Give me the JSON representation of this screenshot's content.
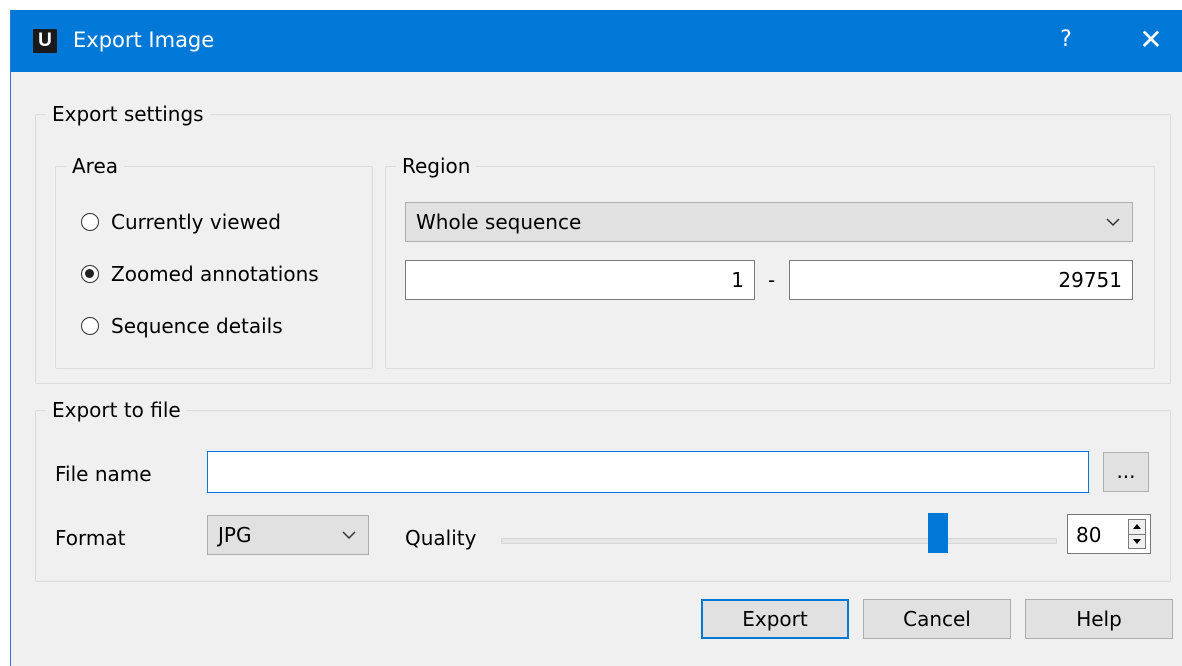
{
  "window": {
    "title": "Export Image",
    "app_logo": "U",
    "help": "?",
    "close": "✕"
  },
  "icons": {
    "chevron": "chevron-down-icon",
    "close": "close-icon",
    "help": "help-icon"
  },
  "colors": {
    "titlebar": "#0078d7",
    "accent": "#0078d7",
    "dialog_bg": "#f0f0f0"
  },
  "export_settings": {
    "legend": "Export settings",
    "area": {
      "legend": "Area",
      "options": [
        {
          "label": "Currently viewed",
          "checked": false
        },
        {
          "label": "Zoomed annotations",
          "checked": true
        },
        {
          "label": "Sequence details",
          "checked": false
        }
      ]
    },
    "region": {
      "legend": "Region",
      "selected": "Whole sequence",
      "start": "1",
      "separator": "-",
      "end": "29751"
    }
  },
  "export_to_file": {
    "legend": "Export to file",
    "file_name_label": "File name",
    "file_name_value": "",
    "browse_label": "...",
    "format_label": "Format",
    "format_value": "JPG",
    "quality_label": "Quality",
    "quality_value": "80",
    "quality_fraction": 0.8
  },
  "buttons": {
    "export": "Export",
    "cancel": "Cancel",
    "help": "Help"
  }
}
